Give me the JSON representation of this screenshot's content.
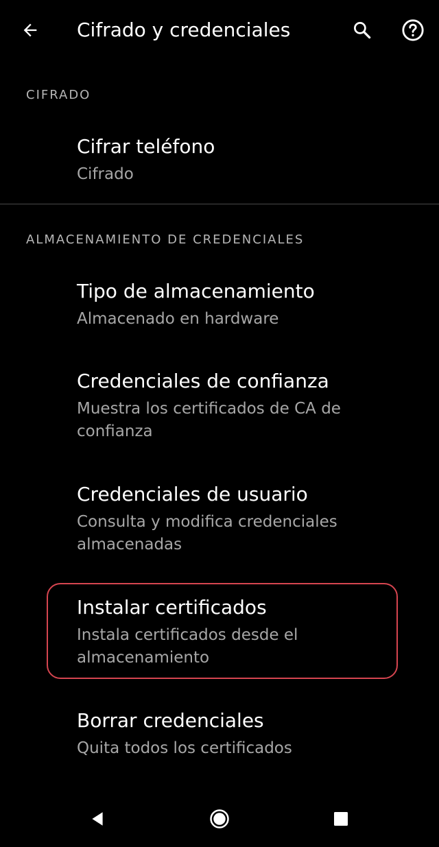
{
  "appbar": {
    "title": "Cifrado y credenciales",
    "back_icon": "arrow-back-icon",
    "search_icon": "search-icon",
    "help_icon": "help-icon"
  },
  "sections": {
    "encryption": {
      "header": "CIFRADO",
      "items": [
        {
          "title": "Cifrar teléfono",
          "summary": "Cifrado"
        }
      ]
    },
    "credential_storage": {
      "header": "ALMACENAMIENTO DE CREDENCIALES",
      "items": [
        {
          "title": "Tipo de almacenamiento",
          "summary": "Almacenado en hardware"
        },
        {
          "title": "Credenciales de confianza",
          "summary": "Muestra los certificados de CA de confianza"
        },
        {
          "title": "Credenciales de usuario",
          "summary": "Consulta y modifica credenciales almacenadas"
        },
        {
          "title": "Instalar certificados",
          "summary": "Instala certificados desde el almacenamiento"
        },
        {
          "title": "Borrar credenciales",
          "summary": "Quita todos los certificados"
        }
      ]
    }
  },
  "highlight_color": "#d64550",
  "navbar": {
    "back_icon": "nav-back-icon",
    "home_icon": "nav-home-icon",
    "recents_icon": "nav-recents-icon"
  }
}
